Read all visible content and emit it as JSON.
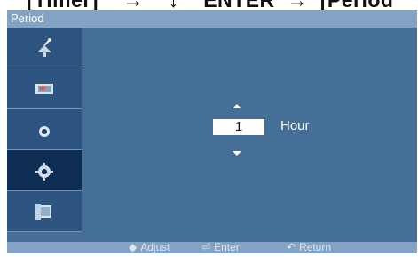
{
  "top_caption": "[Timer]    →    ↓    ENTER  →  [Period",
  "title": "Period",
  "sidebar": {
    "items": [
      {
        "icon": "satellite-dish-icon",
        "selected": false
      },
      {
        "icon": "picture-icon",
        "selected": false
      },
      {
        "icon": "sound-icon",
        "selected": false
      },
      {
        "icon": "setup-gear-icon",
        "selected": true
      },
      {
        "icon": "multi-control-icon",
        "selected": false
      }
    ]
  },
  "setting": {
    "value": "1",
    "unit": "Hour"
  },
  "footer": {
    "adjust": "Adjust",
    "enter": "Enter",
    "return": "Return"
  }
}
